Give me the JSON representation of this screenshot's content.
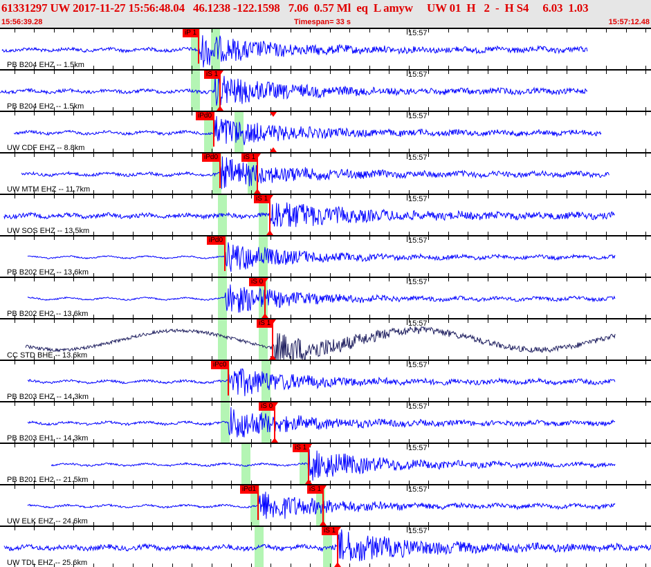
{
  "header": {
    "title": "61331297 UW 2017-11-27 15:56:48.04   46.1238 -122.1598   7.06  0.57 Ml  eq  L amyw     UW 01  H   2  -  H S4     6.03  1.03",
    "start_time": "15:56:39.28",
    "timespan": "Timespan=  33 s",
    "end_time": "15:57:12.48"
  },
  "timeline": {
    "span_seconds": 33,
    "minute_label": "15:57",
    "minute_offset_s": 20.72,
    "first_tick_s": 0.72
  },
  "colors": {
    "trace": "#0000ff",
    "trace_broadband": "#202060",
    "pick": "#ff0000",
    "window": "#b4f5b4",
    "header_text": "#e00000"
  },
  "rows": [
    {
      "station": "PB B204 EHZ -- 1.5km",
      "trace": [
        0.1,
        29.8
      ],
      "onset": 10.1,
      "amp": 5,
      "p_window": 9.92,
      "s_window": 10.91,
      "picks": [
        {
          "label": "iP 1",
          "time": 10.06,
          "kind": "P"
        }
      ]
    },
    {
      "station": "PB B204 EH2 -- 1.5km",
      "trace": [
        0.0,
        29.8
      ],
      "onset": 10.9,
      "amp": 5,
      "p_window": 9.92,
      "s_window": 10.91,
      "picks": [
        {
          "label": "iS 1",
          "time": 11.15,
          "kind": "S"
        }
      ]
    },
    {
      "station": "UW CDF EHZ -- 8.8km",
      "trace": [
        0.7,
        30.5
      ],
      "onset": 10.84,
      "amp": 4,
      "p_window": 10.59,
      "s_window": 12.1,
      "picks": [
        {
          "label": "iPd0",
          "time": 10.84,
          "kind": "P"
        },
        {
          "label": "",
          "time": 13.85,
          "kind": "S"
        }
      ]
    },
    {
      "station": "UW MTM EHZ -- 11.7km",
      "trace": [
        1.1,
        30.9
      ],
      "onset": 11.15,
      "amp": 4,
      "p_window": 10.98,
      "s_window": 12.8,
      "picks": [
        {
          "label": "iPd0",
          "time": 11.15,
          "kind": "P"
        },
        {
          "label": "iS 1",
          "time": 13.05,
          "kind": "S"
        }
      ]
    },
    {
      "station": "UW SOS EHZ -- 13.5km",
      "trace": [
        0.2,
        31.2
      ],
      "onset": 13.68,
      "amp": 7,
      "p_window": 11.29,
      "s_window": 13.33,
      "picks": [
        {
          "label": "iS 1",
          "time": 13.68,
          "kind": "S"
        }
      ]
    },
    {
      "station": "PB B202 EHZ -- 13.6km",
      "trace": [
        1.4,
        31.2
      ],
      "onset": 11.4,
      "amp": 1,
      "p_window": 11.29,
      "s_window": 13.33,
      "picks": [
        {
          "label": "iPd0",
          "time": 11.4,
          "kind": "P"
        }
      ]
    },
    {
      "station": "PB B202 EH2 -- 13.6km",
      "trace": [
        1.4,
        31.2
      ],
      "onset": 11.4,
      "amp": 1,
      "p_window": 11.29,
      "s_window": 13.33,
      "picks": [
        {
          "label": "iS 0",
          "time": 13.43,
          "kind": "S"
        }
      ]
    },
    {
      "station": "CC STD BHE -- 13.6km",
      "trace": [
        1.3,
        31.2
      ],
      "onset": 13.82,
      "amp": 5,
      "broadband": true,
      "p_window": 11.29,
      "s_window": 13.33,
      "picks": [
        {
          "label": "iS 1",
          "time": 13.82,
          "kind": "S"
        }
      ]
    },
    {
      "station": "PB B203 EHZ -- 14.3km",
      "trace": [
        1.4,
        31.2
      ],
      "onset": 11.57,
      "amp": 3,
      "p_window": 11.4,
      "s_window": 13.5,
      "picks": [
        {
          "label": "iPc0",
          "time": 11.57,
          "kind": "P"
        }
      ]
    },
    {
      "station": "PB B203 EH1 -- 14.3km",
      "trace": [
        1.4,
        31.2
      ],
      "onset": 11.6,
      "amp": 3,
      "p_window": 11.4,
      "s_window": 13.5,
      "picks": [
        {
          "label": "iS 0",
          "time": 13.92,
          "kind": "S"
        }
      ]
    },
    {
      "station": "PB B201 EH2 -- 21.5km",
      "trace": [
        2.6,
        31.2
      ],
      "onset": 15.64,
      "amp": 2,
      "p_window": 12.45,
      "s_window": 15.43,
      "picks": [
        {
          "label": "iS 1",
          "time": 15.64,
          "kind": "S"
        }
      ]
    },
    {
      "station": "UW ELK EHZ -- 24.6km",
      "trace": [
        1.4,
        31.2
      ],
      "onset": 13.08,
      "amp": 2,
      "p_window": 12.94,
      "s_window": 16.27,
      "picks": [
        {
          "label": "iPd1",
          "time": 13.08,
          "kind": "P"
        },
        {
          "label": "iS 1",
          "time": 16.38,
          "kind": "S"
        }
      ]
    },
    {
      "station": "UW TDL EHZ -- 25.6km",
      "trace": [
        0.2,
        33.0
      ],
      "onset": 17.11,
      "amp": 8,
      "p_window": 13.12,
      "s_window": 16.62,
      "picks": [
        {
          "label": "iS 1",
          "time": 17.11,
          "kind": "S"
        }
      ]
    }
  ]
}
